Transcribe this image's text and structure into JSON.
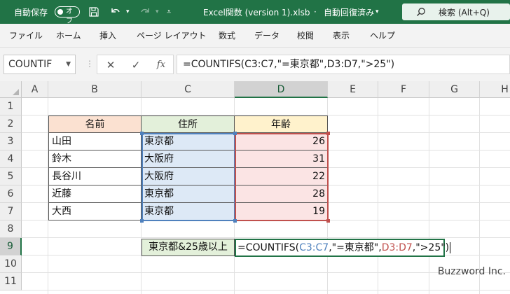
{
  "titlebar": {
    "autosave_label": "自動保存",
    "autosave_state": "オフ",
    "filename": "Excel関数 (version 1).xlsb",
    "save_status": "自動回復済み",
    "search_placeholder": "検索 (Alt+Q)"
  },
  "ribbon": {
    "tabs": [
      "ファイル",
      "ホーム",
      "挿入",
      "ページ レイアウト",
      "数式",
      "データ",
      "校閲",
      "表示",
      "ヘルプ"
    ]
  },
  "formula_bar": {
    "name_box": "COUNTIF",
    "fx": "fx",
    "formula": "=COUNTIFS(C3:C7,\"=東京都\",D3:D7,\">25\")"
  },
  "sheet": {
    "columns": [
      "A",
      "B",
      "C",
      "D",
      "E",
      "F",
      "G",
      "H"
    ],
    "rows": [
      "1",
      "2",
      "3",
      "4",
      "5",
      "6",
      "7",
      "8",
      "9",
      "10",
      "11"
    ],
    "headers": {
      "name": "名前",
      "address": "住所",
      "age": "年齢"
    },
    "data": [
      {
        "name": "山田",
        "address": "東京都",
        "age": "26"
      },
      {
        "name": "鈴木",
        "address": "大阪府",
        "age": "31"
      },
      {
        "name": "長谷川",
        "address": "大阪府",
        "age": "22"
      },
      {
        "name": "近藤",
        "address": "東京都",
        "age": "28"
      },
      {
        "name": "大西",
        "address": "東京都",
        "age": "19"
      }
    ],
    "label_c9": "東京都&25歳以上",
    "edit_d9": {
      "p1": "=COUNTIFS(",
      "r1": "C3:C7",
      "p2": ",\"=東京都\",",
      "r2": "D3:D7",
      "p3": ",\">25\")"
    },
    "credit": "Buzzword Inc."
  },
  "colors": {
    "excel_green": "#217346",
    "range_blue": "#4f81bd",
    "range_red": "#c0504d"
  }
}
